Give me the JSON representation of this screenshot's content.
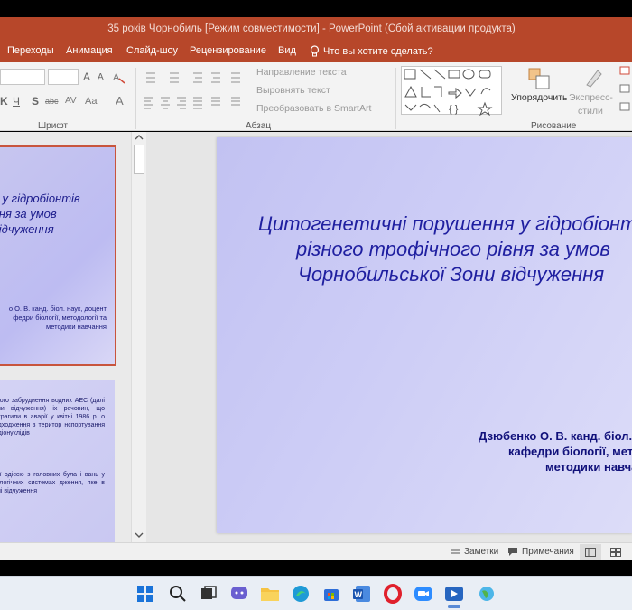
{
  "window": {
    "title": "35 років Чорнобиль [Режим совместимости] - PowerPoint (Сбой активации продукта)"
  },
  "tabs": [
    "Переходы",
    "Анимация",
    "Слайд-шоу",
    "Рецензирование",
    "Вид"
  ],
  "tell_me": "Что вы хотите сделать?",
  "ribbon": {
    "groups": {
      "font": "Шрифт",
      "paragraph": "Абзац",
      "drawing": "Рисование"
    },
    "font_buttons": {
      "bold_k": "K",
      "shadow_s": "S",
      "grow": "A",
      "shrink": "A",
      "change_case": "Aa",
      "font_color": "A"
    },
    "text_direction": "Направление текста",
    "align_text": "Выровнять текст",
    "smartart": "Преобразовать в SmartArt",
    "arrange": "Упорядочить",
    "quick_styles_1": "Экспресс-",
    "quick_styles_2": "стили"
  },
  "thumb1": {
    "title_lines": [
      "я у гідробіонтів",
      "вня за умов",
      "відчуження"
    ],
    "author_lines": [
      "о О. В. канд. біол. наук, доцент",
      "федри біології, методології та",
      "методики навчання"
    ]
  },
  "thumb2": {
    "para1": "лідого забруднення водних АЕС (далі зони відчуження) іх речовин, що потрагили в аварії у квітні 1986 р. о надходження з територ нспортування радіонуклідів",
    "para2": "одії одієсю з головних була і вань у біологічних системах дження, яке в зоні відчуження"
  },
  "slide": {
    "title_lines": [
      "Цитогенетичні порушення у гідробіонтів",
      "різного трофічного рівня за умов",
      "Чорнобильської Зони відчуження"
    ],
    "author_lines": [
      "Дзюбенко О. В. канд. біол. наук, доцент",
      "кафедри біології, методології та",
      "методики навчання"
    ]
  },
  "statusbar": {
    "notes": "Заметки",
    "comments": "Примечания"
  },
  "colors": {
    "accent": "#b7472a",
    "slide_title": "#1f1fa0",
    "selection": "#c8553d"
  }
}
